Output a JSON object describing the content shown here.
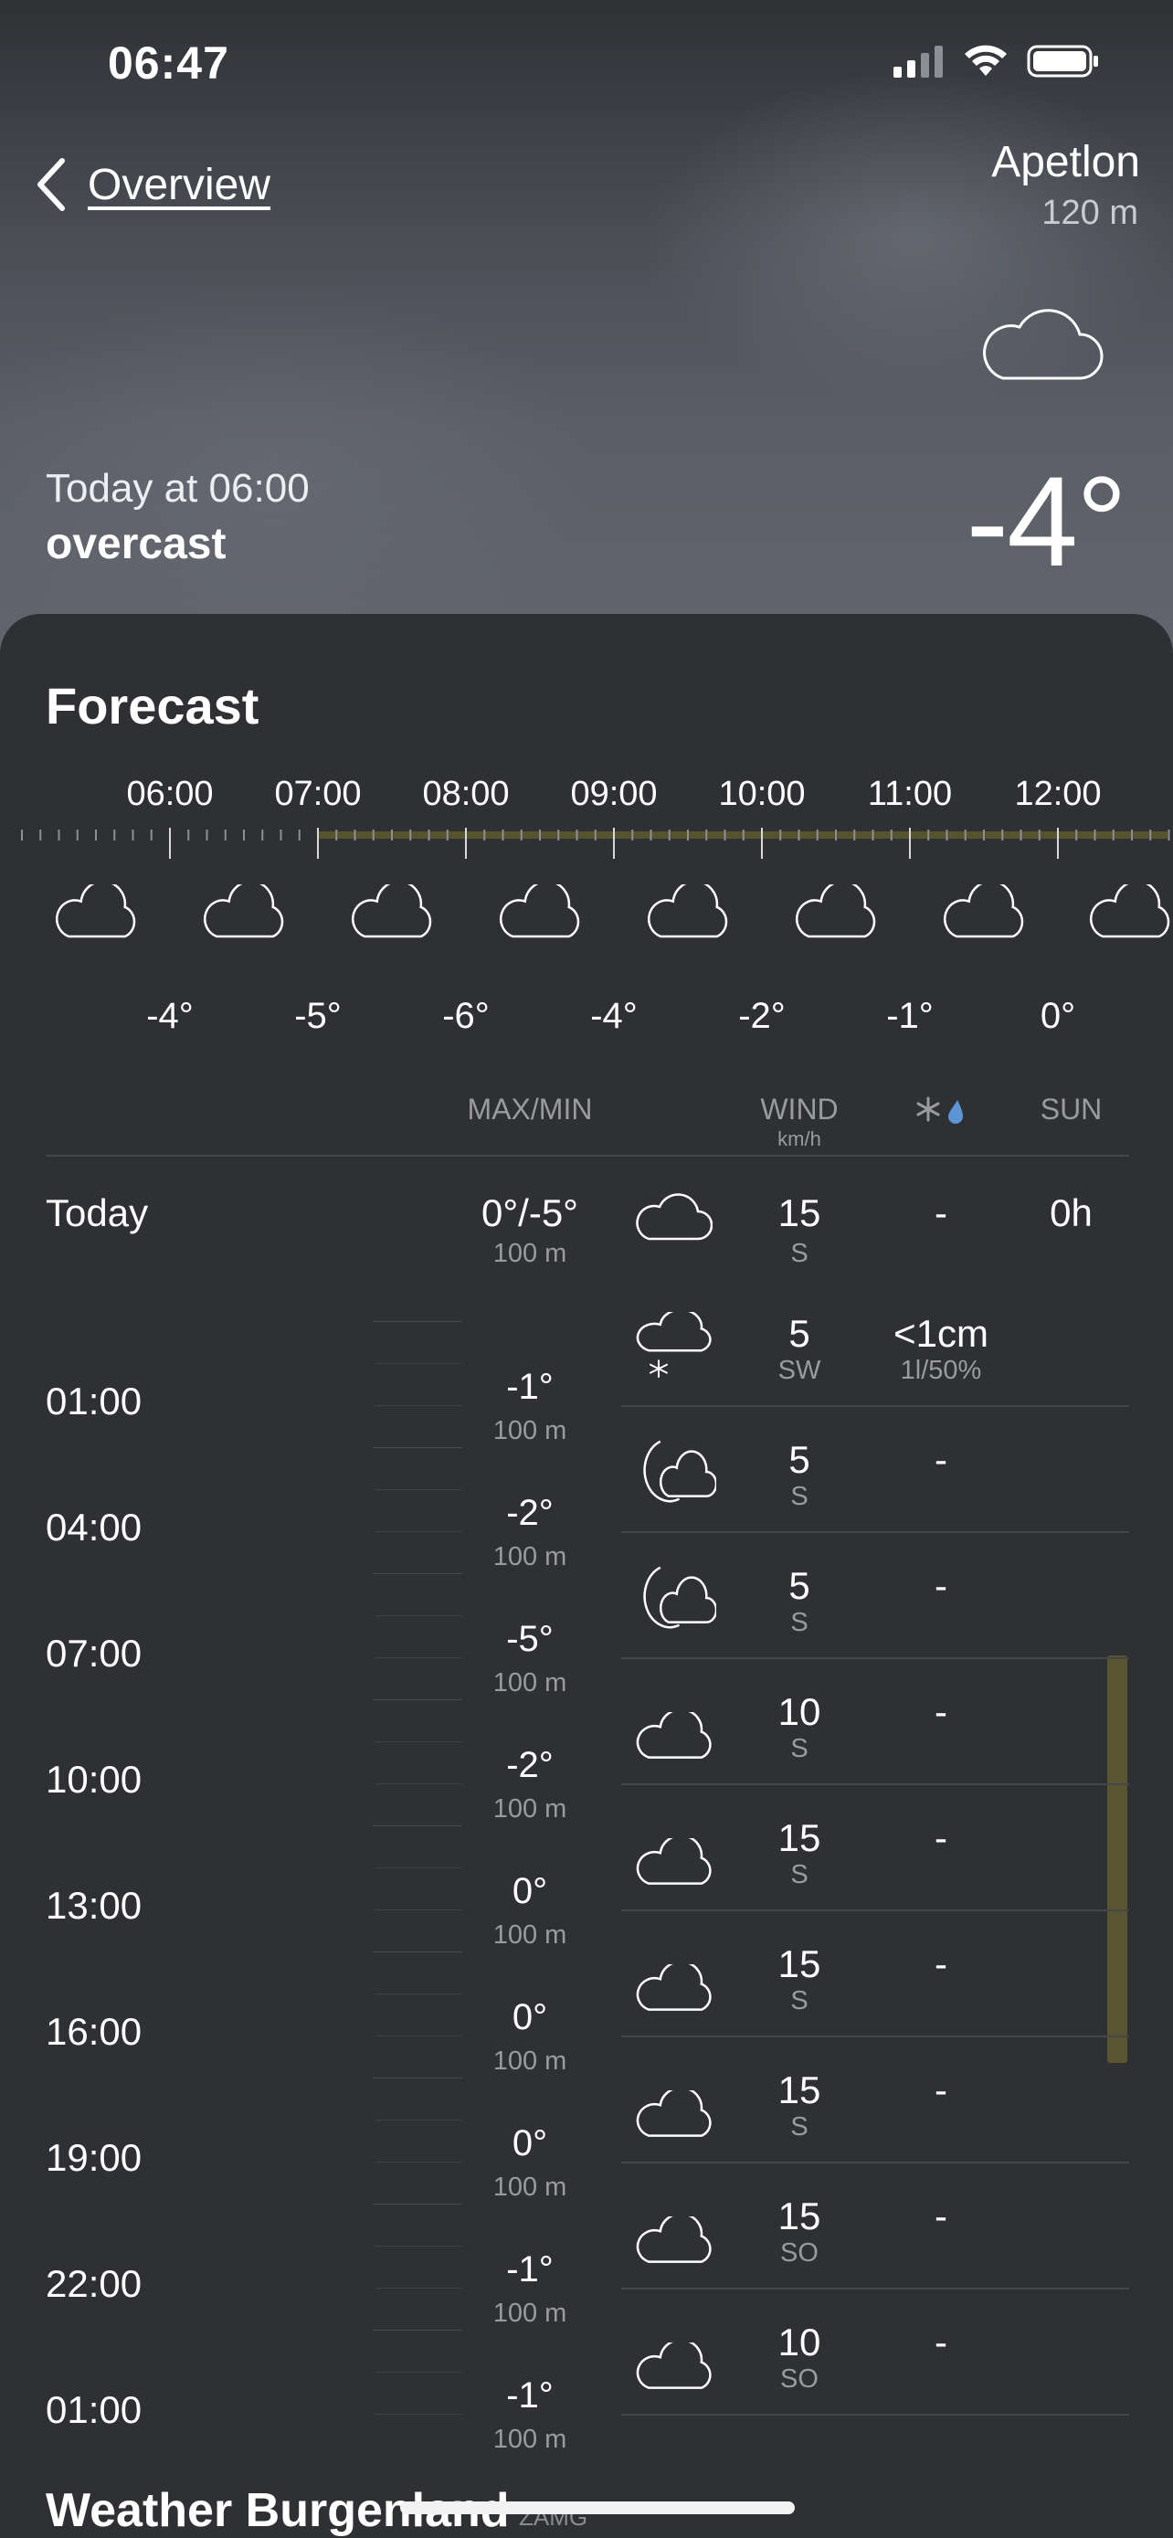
{
  "status_bar": {
    "time": "06:47"
  },
  "nav": {
    "back_label": "Overview"
  },
  "location": {
    "name": "Apetlon",
    "altitude": "120 m"
  },
  "current": {
    "when": "Today at 06:00",
    "condition": "overcast",
    "temperature": "-4°",
    "icon": "cloud-icon"
  },
  "forecast": {
    "title": "Forecast",
    "hourly": [
      {
        "time": "06:00",
        "temp": "-4°",
        "icon": "cloud-icon"
      },
      {
        "time": "07:00",
        "temp": "-5°",
        "icon": "cloud-icon"
      },
      {
        "time": "08:00",
        "temp": "-6°",
        "icon": "cloud-icon"
      },
      {
        "time": "09:00",
        "temp": "-4°",
        "icon": "cloud-icon"
      },
      {
        "time": "10:00",
        "temp": "-2°",
        "icon": "cloud-icon"
      },
      {
        "time": "11:00",
        "temp": "-1°",
        "icon": "cloud-icon"
      },
      {
        "time": "12:00",
        "temp": "0°",
        "icon": "cloud-icon"
      }
    ],
    "table": {
      "headers": {
        "maxmin": "MAX/MIN",
        "wind": "WIND",
        "wind_unit": "km/h",
        "sun": "SUN",
        "precip_icon": "snow-rain-icon"
      },
      "today": {
        "label": "Today",
        "maxmin": "0°/-5°",
        "altitude": "100 m",
        "wind": "15",
        "wind_dir": "S",
        "precip": "-",
        "sun": "0h",
        "icon": "cloud-icon"
      },
      "rows": [
        {
          "time": "01:00",
          "temp": "-1°",
          "alt": "100 m",
          "wind": "5",
          "dir": "SW",
          "precip": "<1cm",
          "precip_sub": "1l/50%",
          "icon": "cloud-snow-icon"
        },
        {
          "time": "04:00",
          "temp": "-2°",
          "alt": "100 m",
          "wind": "5",
          "dir": "S",
          "precip": "-",
          "icon": "moon-cloud-icon"
        },
        {
          "time": "07:00",
          "temp": "-5°",
          "alt": "100 m",
          "wind": "5",
          "dir": "S",
          "precip": "-",
          "icon": "moon-cloud-icon"
        },
        {
          "time": "10:00",
          "temp": "-2°",
          "alt": "100 m",
          "wind": "10",
          "dir": "S",
          "precip": "-",
          "icon": "cloud-icon"
        },
        {
          "time": "13:00",
          "temp": "0°",
          "alt": "100 m",
          "wind": "15",
          "dir": "S",
          "precip": "-",
          "icon": "cloud-icon"
        },
        {
          "time": "16:00",
          "temp": "0°",
          "alt": "100 m",
          "wind": "15",
          "dir": "S",
          "precip": "-",
          "icon": "cloud-icon"
        },
        {
          "time": "19:00",
          "temp": "0°",
          "alt": "100 m",
          "wind": "15",
          "dir": "S",
          "precip": "-",
          "icon": "cloud-icon"
        },
        {
          "time": "22:00",
          "temp": "-1°",
          "alt": "100 m",
          "wind": "15",
          "dir": "SO",
          "precip": "-",
          "icon": "cloud-icon"
        },
        {
          "time": "01:00",
          "temp": "-1°",
          "alt": "100 m",
          "wind": "10",
          "dir": "SO",
          "precip": "-",
          "icon": "cloud-icon"
        }
      ]
    }
  },
  "footer": {
    "title": "Weather Burgenland",
    "source": "ZAMG"
  }
}
